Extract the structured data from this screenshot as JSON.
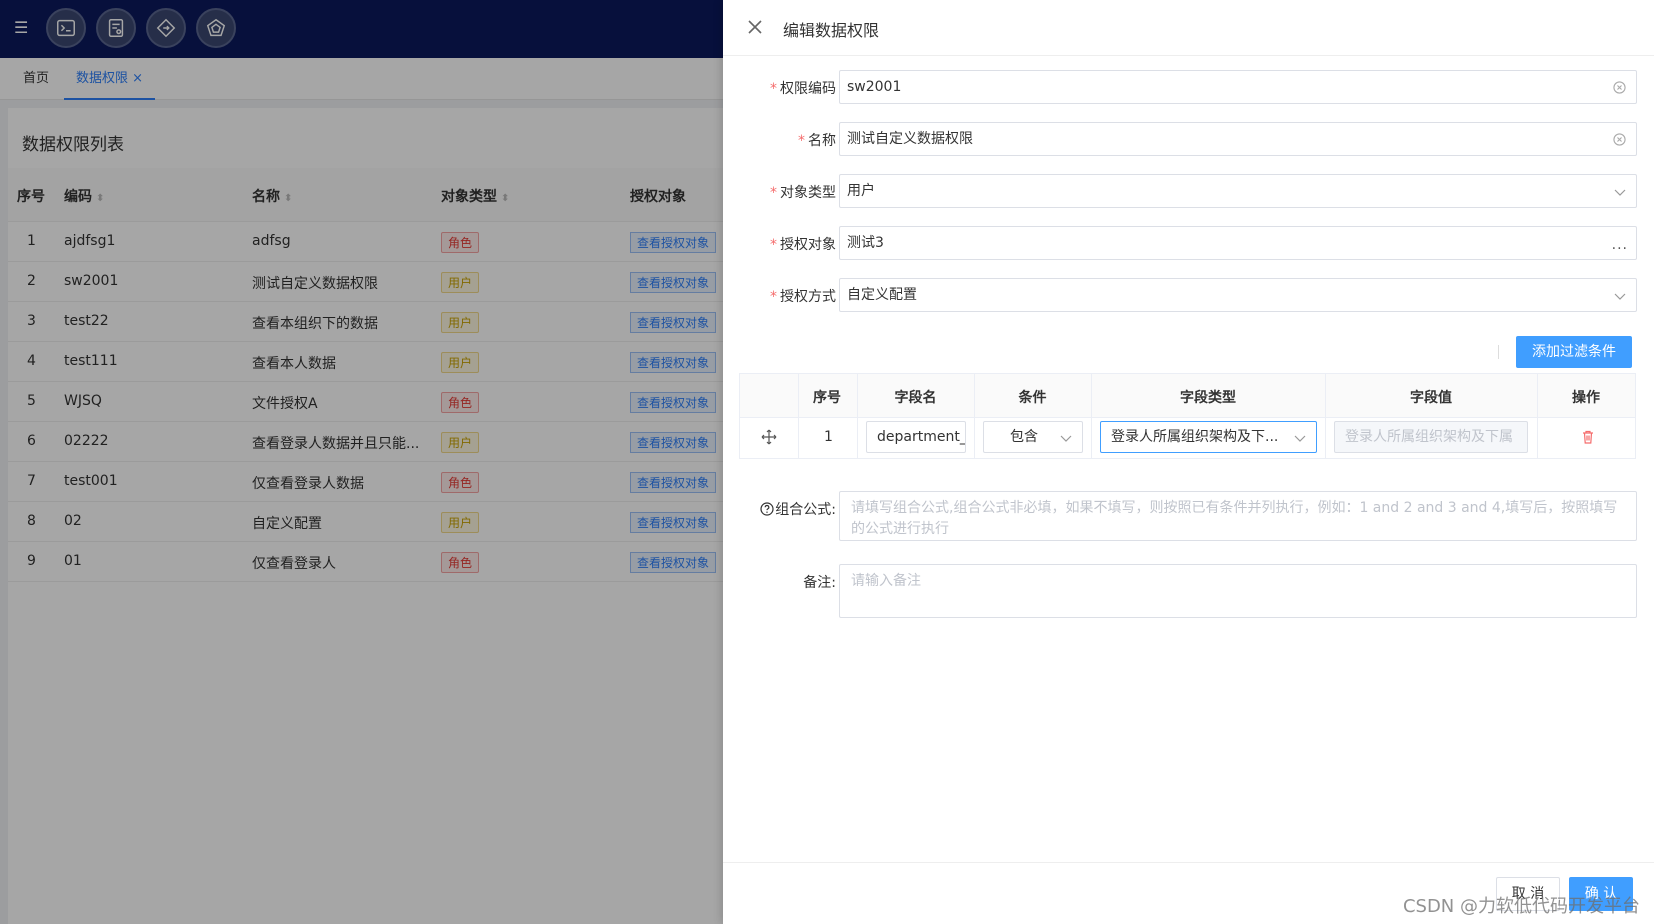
{
  "tabs": [
    {
      "label": "首页"
    },
    {
      "label": "数据权限"
    }
  ],
  "tab_close": "×",
  "list": {
    "title": "数据权限列表",
    "columns": [
      "序号",
      "编码",
      "名称",
      "对象类型",
      "授权对象"
    ],
    "view_label": "查看授权对象",
    "rows": [
      {
        "idx": "1",
        "code": "ajdfsg1",
        "name": "adfsg",
        "type": "角色",
        "kind": "role"
      },
      {
        "idx": "2",
        "code": "sw2001",
        "name": "测试自定义数据权限",
        "type": "用户",
        "kind": "user"
      },
      {
        "idx": "3",
        "code": "test22",
        "name": "查看本组织下的数据",
        "type": "用户",
        "kind": "user"
      },
      {
        "idx": "4",
        "code": "test111",
        "name": "查看本人数据",
        "type": "用户",
        "kind": "user"
      },
      {
        "idx": "5",
        "code": "WJSQ",
        "name": "文件授权A",
        "type": "角色",
        "kind": "role"
      },
      {
        "idx": "6",
        "code": "02222",
        "name": "查看登录人数据并且只能...",
        "type": "用户",
        "kind": "user"
      },
      {
        "idx": "7",
        "code": "test001",
        "name": "仅查看登录人数据",
        "type": "角色",
        "kind": "role"
      },
      {
        "idx": "8",
        "code": "02",
        "name": "自定义配置",
        "type": "用户",
        "kind": "user"
      },
      {
        "idx": "9",
        "code": "01",
        "name": "仅查看登录人",
        "type": "角色",
        "kind": "role"
      }
    ]
  },
  "drawer": {
    "title": "编辑数据权限",
    "fields": {
      "code": {
        "label": "权限编码",
        "value": "sw2001"
      },
      "name": {
        "label": "名称",
        "value": "测试自定义数据权限"
      },
      "object_type": {
        "label": "对象类型",
        "value": "用户"
      },
      "auth_object": {
        "label": "授权对象",
        "value": "测试3"
      },
      "auth_method": {
        "label": "授权方式",
        "value": "自定义配置"
      }
    },
    "add_filter_label": "添加过滤条件",
    "filter_table": {
      "columns": [
        "序号",
        "字段名",
        "条件",
        "字段类型",
        "字段值",
        "操作"
      ],
      "row": {
        "idx": "1",
        "field_name": "department_",
        "condition": "包含",
        "field_type": "登录人所属组织架构及下...",
        "field_value_placeholder": "登录人所属组织架构及下属"
      }
    },
    "formula": {
      "label": "组合公式:",
      "placeholder": "请填写组合公式,组合公式非必填，如果不填写，则按照已有条件并列执行，例如：1 and 2 and 3 and 4,填写后，按照填写的公式进行执行"
    },
    "remark": {
      "label": "备注:",
      "placeholder": "请输入备注"
    },
    "cancel_label": "取 消",
    "ok_label": "确 认"
  },
  "watermark": "CSDN @力软低代码开发平台",
  "colors": {
    "topbar": "#0c1a5c",
    "primary": "#409eff",
    "required": "#f56c6c",
    "role_tag": "#e53935",
    "user_tag": "#c8a100"
  }
}
